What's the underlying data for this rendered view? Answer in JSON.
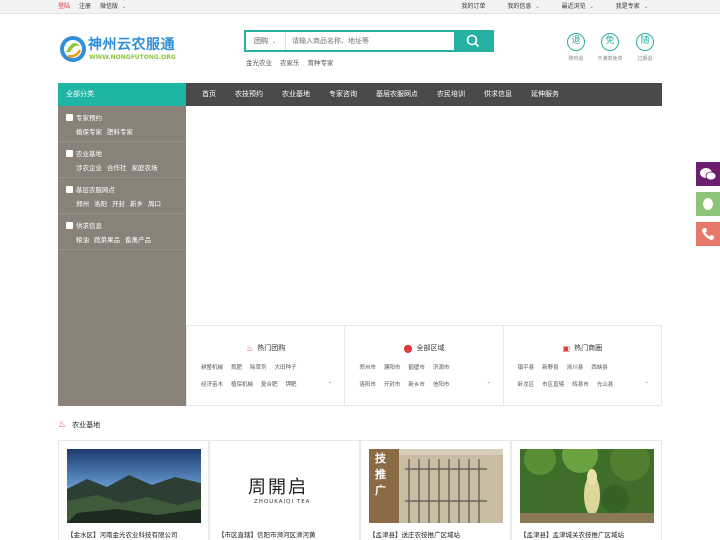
{
  "topbar": {
    "login": "登陆",
    "register": "注册",
    "mobile": "微信版",
    "orders": "我的订单",
    "my_info": "我的信息",
    "recent": "最近浏览",
    "expert": "我是专家"
  },
  "header": {
    "logo_title": "神州云农服通",
    "logo_url": "WWW.NONGFUTONG.ORG",
    "search_type": "团购",
    "search_placeholder": "请输入商品名称、地址等",
    "hotwords": [
      "金光农业",
      "农家乐",
      "育种专家"
    ],
    "services": [
      {
        "icon": "退",
        "label": "随时退"
      },
      {
        "icon": "免",
        "label": "不满意免单"
      },
      {
        "icon": "随",
        "label": "过期退"
      }
    ]
  },
  "nav": {
    "category_title": "全部分类",
    "items": [
      "首页",
      "农技预约",
      "农业基地",
      "专家咨询",
      "基层农服网点",
      "农民培训",
      "供求信息",
      "延伸服务"
    ]
  },
  "sidebar": [
    {
      "title": "专家预约",
      "links": [
        "植保专家",
        "肥料专家"
      ]
    },
    {
      "title": "农业基地",
      "links": [
        "涉农企业",
        "合作社",
        "家庭农场"
      ]
    },
    {
      "title": "基层农服网点",
      "links": [
        "郑州",
        "洛阳",
        "开封",
        "新乡",
        "周口"
      ]
    },
    {
      "title": "供求信息",
      "links": [
        "粮油",
        "蔬菜果品",
        "畜禽产品"
      ]
    }
  ],
  "panels": [
    {
      "title": "热门团购",
      "row1": [
        "耕整机械",
        "氮肥",
        "除草剂",
        "大田种子"
      ],
      "row2": [
        "经济苗木",
        "植保机械",
        "复合肥",
        "钾肥"
      ]
    },
    {
      "title": "全部区域",
      "row1": [
        "郑州市",
        "濮阳市",
        "鹤壁市",
        "济源市"
      ],
      "row2": [
        "洛阳市",
        "开封市",
        "新乡市",
        "信阳市"
      ]
    },
    {
      "title": "热门商圈",
      "row1": [
        "镇平县",
        "新野县",
        "淅川县",
        "西峡县"
      ],
      "row2": [
        "卧龙区",
        "市区直辖",
        "辉县市",
        "光山县"
      ]
    }
  ],
  "section": {
    "title": "农业基地",
    "cards": [
      "【金水区】河南金光农业科技有限公司",
      "【市区直辖】信阳市浉河区浉河黄",
      "【孟津县】送庄农技推广区域站",
      "【孟津县】孟津城关农技推广区域站"
    ],
    "card2_logo": "周開启",
    "card2_logo_sub": "ZHOUKAIQI TEA",
    "card3_sign": "技推广"
  },
  "colors": {
    "accent": "#1fb5a5",
    "nav_bg": "#4a4a4a",
    "sidebar_bg": "#8a8178",
    "red": "#e4393c"
  }
}
